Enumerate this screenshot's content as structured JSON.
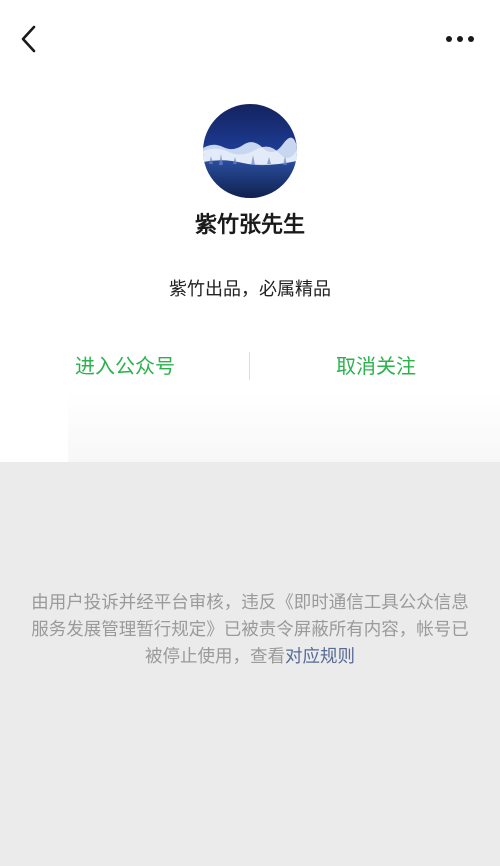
{
  "nav": {
    "back_icon": "chevron-left-icon",
    "more_icon": "more-horizontal-icon"
  },
  "profile": {
    "avatar": "blue-landscape-avatar",
    "name": "紫竹张先生",
    "description": "紫竹出品，必属精品"
  },
  "actions": {
    "enter_label": "进入公众号",
    "unfollow_label": "取消关注",
    "accent_color": "#2bb24c"
  },
  "notice": {
    "text": "由用户投诉并经平台审核，违反《即时通信工具公众信息服务发展管理暂行规定》已被责令屏蔽所有内容，帐号已被停止使用，查看",
    "link_text": "对应规则",
    "text_color": "#9a9a9a",
    "link_color": "#576b95"
  }
}
